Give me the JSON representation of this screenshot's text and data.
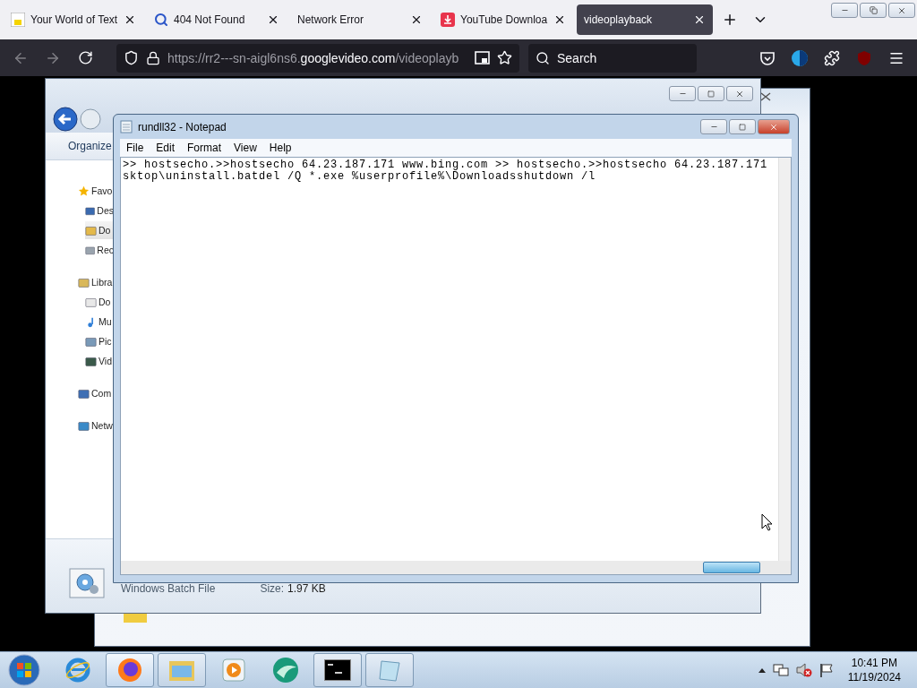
{
  "browser": {
    "tabs": [
      {
        "label": "Your World of Text",
        "selected": false,
        "kind": "text"
      },
      {
        "label": "404 Not Found",
        "selected": false,
        "kind": "search"
      },
      {
        "label": "Network Error",
        "selected": false,
        "kind": "none"
      },
      {
        "label": "YouTube Downloa",
        "selected": false,
        "kind": "download"
      },
      {
        "label": "videoplayback",
        "selected": true,
        "kind": "none"
      }
    ],
    "url": {
      "before": "https://rr2---sn-aigl6ns6.",
      "domain": "googlevideo.com",
      "after": "/videoplayb"
    },
    "search": {
      "placeholder": "Search"
    }
  },
  "video": {
    "explorer": {
      "toolbar": "Organize",
      "sidebar": [
        {
          "label": "Favo",
          "kind": "star",
          "selected": false
        },
        {
          "label": "Des",
          "kind": "desktop",
          "selected": false
        },
        {
          "label": "Do",
          "kind": "download",
          "selected": true
        },
        {
          "label": "Rec",
          "kind": "recent",
          "selected": false
        },
        {
          "label": "Libra",
          "kind": "library",
          "selected": false
        },
        {
          "label": "Do",
          "kind": "doc",
          "selected": false
        },
        {
          "label": "Mu",
          "kind": "music",
          "selected": false
        },
        {
          "label": "Pic",
          "kind": "pictures",
          "selected": false
        },
        {
          "label": "Vid",
          "kind": "video",
          "selected": false
        },
        {
          "label": "Com",
          "kind": "computer",
          "selected": false
        },
        {
          "label": "Netw",
          "kind": "network",
          "selected": false
        }
      ],
      "file_type": "Windows Batch File",
      "size_label": "Size:",
      "size_value": "1.97 KB"
    },
    "notepad": {
      "title": "rundll32 - Notepad",
      "menu": [
        "File",
        "Edit",
        "Format",
        "View",
        "Help"
      ],
      "lines": [
        ">> hostsecho.>>hostsecho 64.23.187.171 www.bing.com >> hostsecho.>>hostsecho 64.23.187.171",
        "sktop\\uninstall.batdel /Q *.exe %userprofile%\\Downloadsshutdown /l"
      ]
    },
    "taskbar": {
      "apps": [
        {
          "kind": "ie",
          "active": false,
          "running": false
        },
        {
          "kind": "firefox",
          "active": true,
          "running": true
        },
        {
          "kind": "folder",
          "active": false,
          "running": true
        },
        {
          "kind": "media",
          "active": false,
          "running": false
        },
        {
          "kind": "green",
          "active": false,
          "running": false
        },
        {
          "kind": "cmd",
          "active": false,
          "running": true
        },
        {
          "kind": "notepad",
          "active": false,
          "running": true
        }
      ],
      "time": "10:41 PM",
      "date": "11/19/2024"
    }
  }
}
